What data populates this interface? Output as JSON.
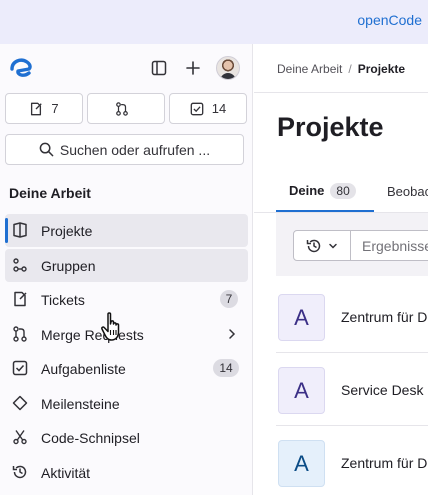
{
  "topbar": {
    "brand": "openCode"
  },
  "sidebar": {
    "counters": [
      {
        "icon": "issues-icon",
        "value": "7"
      },
      {
        "icon": "merge-request-icon",
        "value": ""
      },
      {
        "icon": "todo-icon",
        "value": "14"
      }
    ],
    "search_label": "Suchen oder aufrufen ...",
    "section_title": "Deine Arbeit",
    "items": [
      {
        "label": "Projekte",
        "icon": "project-icon",
        "state": "active"
      },
      {
        "label": "Gruppen",
        "icon": "group-icon",
        "state": "hover"
      },
      {
        "label": "Tickets",
        "icon": "issues-icon",
        "badge": "7"
      },
      {
        "label": "Merge Requests",
        "icon": "merge-request-icon",
        "chevron": true
      },
      {
        "label": "Aufgabenliste",
        "icon": "todo-icon",
        "badge": "14"
      },
      {
        "label": "Meilensteine",
        "icon": "milestone-icon"
      },
      {
        "label": "Code-Schnipsel",
        "icon": "snippet-icon"
      },
      {
        "label": "Aktivität",
        "icon": "history-icon"
      }
    ]
  },
  "main": {
    "breadcrumb": {
      "parent": "Deine Arbeit",
      "current": "Projekte"
    },
    "title": "Projekte",
    "tabs": [
      {
        "label": "Deine",
        "count": "80"
      },
      {
        "label": "Beobachtet"
      }
    ],
    "filter": {
      "placeholder": "Ergebnisse filtern"
    },
    "projects": [
      {
        "letter": "A",
        "name": "Zentrum für Digitale Souveränität",
        "color": "#f0eefb"
      },
      {
        "letter": "A",
        "name": "Service Desk",
        "color": "#f0eefb"
      },
      {
        "letter": "A",
        "name": "Zentrum für Digitale Souveränität",
        "color": "#e5f0fb"
      }
    ]
  }
}
